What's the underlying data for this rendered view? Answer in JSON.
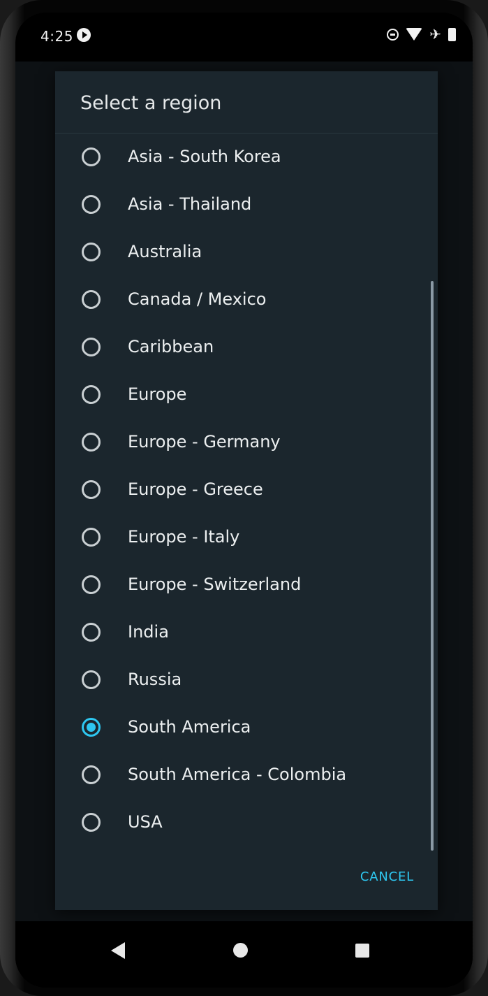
{
  "status_bar": {
    "time": "4:25",
    "icons": [
      "play-notification-icon",
      "do-not-disturb-icon",
      "wifi-icon",
      "airplane-mode-icon",
      "battery-icon"
    ]
  },
  "dialog": {
    "title": "Select a region",
    "options": [
      {
        "label": "Asia - South Korea",
        "selected": false
      },
      {
        "label": "Asia - Thailand",
        "selected": false
      },
      {
        "label": "Australia",
        "selected": false
      },
      {
        "label": "Canada / Mexico",
        "selected": false
      },
      {
        "label": "Caribbean",
        "selected": false
      },
      {
        "label": "Europe",
        "selected": false
      },
      {
        "label": "Europe - Germany",
        "selected": false
      },
      {
        "label": "Europe - Greece",
        "selected": false
      },
      {
        "label": "Europe - Italy",
        "selected": false
      },
      {
        "label": "Europe - Switzerland",
        "selected": false
      },
      {
        "label": "India",
        "selected": false
      },
      {
        "label": "Russia",
        "selected": false
      },
      {
        "label": "South America",
        "selected": true
      },
      {
        "label": "South America - Colombia",
        "selected": false
      },
      {
        "label": "USA",
        "selected": false
      }
    ],
    "cancel_label": "CANCEL"
  },
  "navigation": {
    "icons": [
      "back-icon",
      "home-icon",
      "recents-icon"
    ]
  },
  "colors": {
    "accent": "#2ec7f0",
    "dialog_background": "#1b262d"
  }
}
